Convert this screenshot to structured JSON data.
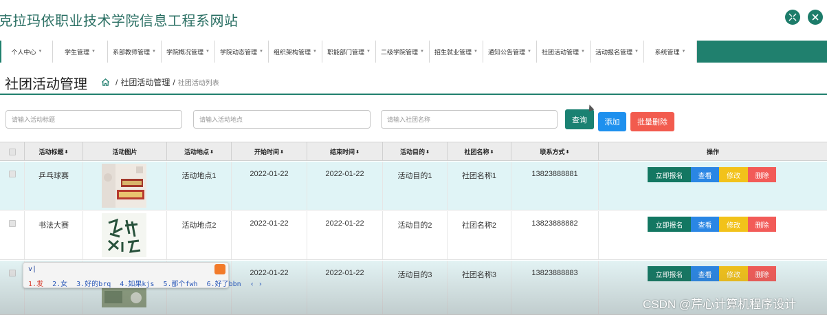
{
  "site": {
    "title": "克拉玛依职业技术学院信息工程系网站"
  },
  "header_icons": [
    "fullscreen-icon",
    "close-icon"
  ],
  "nav": [
    {
      "label": "个人中心"
    },
    {
      "label": "学生管理"
    },
    {
      "label": "系部教师管理"
    },
    {
      "label": "学院概况管理"
    },
    {
      "label": "学院动态管理"
    },
    {
      "label": "组织架构管理"
    },
    {
      "label": "职能部门管理"
    },
    {
      "label": "二级学院管理"
    },
    {
      "label": "招生就业管理"
    },
    {
      "label": "通知公告管理"
    },
    {
      "label": "社团活动管理"
    },
    {
      "label": "活动报名管理"
    },
    {
      "label": "系统管理"
    }
  ],
  "page": {
    "title": "社团活动管理",
    "breadcrumb": {
      "parent": "社团活动管理",
      "current": "社团活动列表",
      "sep": "/"
    }
  },
  "search": {
    "title_placeholder": "请输入活动标题",
    "place_placeholder": "请输入活动地点",
    "club_placeholder": "请输入社团名称",
    "query_label": "查询",
    "add_label": "添加",
    "batch_delete_label": "批量删除"
  },
  "table": {
    "headers": [
      "活动标题",
      "活动图片",
      "活动地点",
      "开始时间",
      "结束时间",
      "活动目的",
      "社团名称",
      "联系方式",
      "操作"
    ],
    "sort_glyph": "⬍",
    "rows": [
      {
        "title": "乒乓球赛",
        "place": "活动地点1",
        "start": "2022-01-22",
        "end": "2022-01-22",
        "purpose": "活动目的1",
        "club": "社团名称1",
        "phone": "13823888881"
      },
      {
        "title": "书法大赛",
        "place": "活动地点2",
        "start": "2022-01-22",
        "end": "2022-01-22",
        "purpose": "活动目的2",
        "club": "社团名称2",
        "phone": "13823888882"
      },
      {
        "title": "",
        "place": "",
        "start": "2022-01-22",
        "end": "2022-01-22",
        "purpose": "活动目的3",
        "club": "社团名称3",
        "phone": "13823888883"
      }
    ],
    "actions": {
      "signup": "立即报名",
      "view": "查看",
      "edit": "修改",
      "delete": "删除"
    }
  },
  "ime": {
    "input": "v|",
    "candidates": [
      "1.发",
      "2.女",
      "3.好的brq",
      "4.如果kjs",
      "5.那个fwh",
      "6.好了bbn",
      "‹ ›"
    ]
  },
  "watermark": "CSDN @芹心计算机程序设计",
  "colors": {
    "brand": "#20806e",
    "add": "#1e90ee",
    "danger": "#f25b4e",
    "edit": "#f2c21a"
  }
}
